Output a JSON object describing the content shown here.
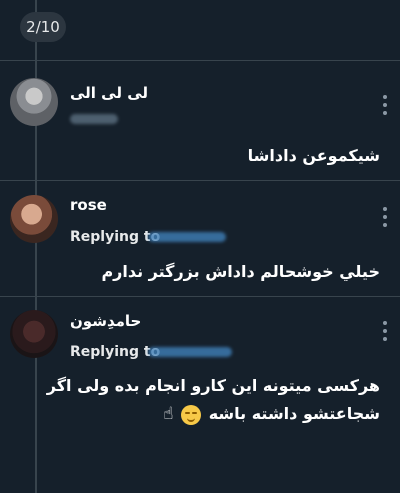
{
  "viewer": {
    "counter": "2/10"
  },
  "tweets": [
    {
      "name": "لی لی الی",
      "handle": "@lili_alii",
      "text_lines": [
        "شیکموعن داداشا"
      ]
    },
    {
      "name": "rose",
      "replying_label": "Replying to",
      "replying_handle": "@roseleaab_",
      "text_lines": [
        "خيلي خوشحالم داداش بزرگتر ندارم"
      ]
    },
    {
      "name": "حامدِشون",
      "replying_label": "Replying to",
      "replying_handle": "@hamed_mkh",
      "text_lines": [
        "هرکسی میتونه این کارو انجام بده ولی اگر",
        "شجاعتشو داشته باشه"
      ],
      "emojis": [
        "relieved-face",
        "☝"
      ]
    }
  ],
  "colors": {
    "background": "#15202b",
    "divider": "#38444d",
    "text": "#ffffff",
    "secondary": "#8b98a5",
    "handle_blue": "#3f7fb8"
  }
}
